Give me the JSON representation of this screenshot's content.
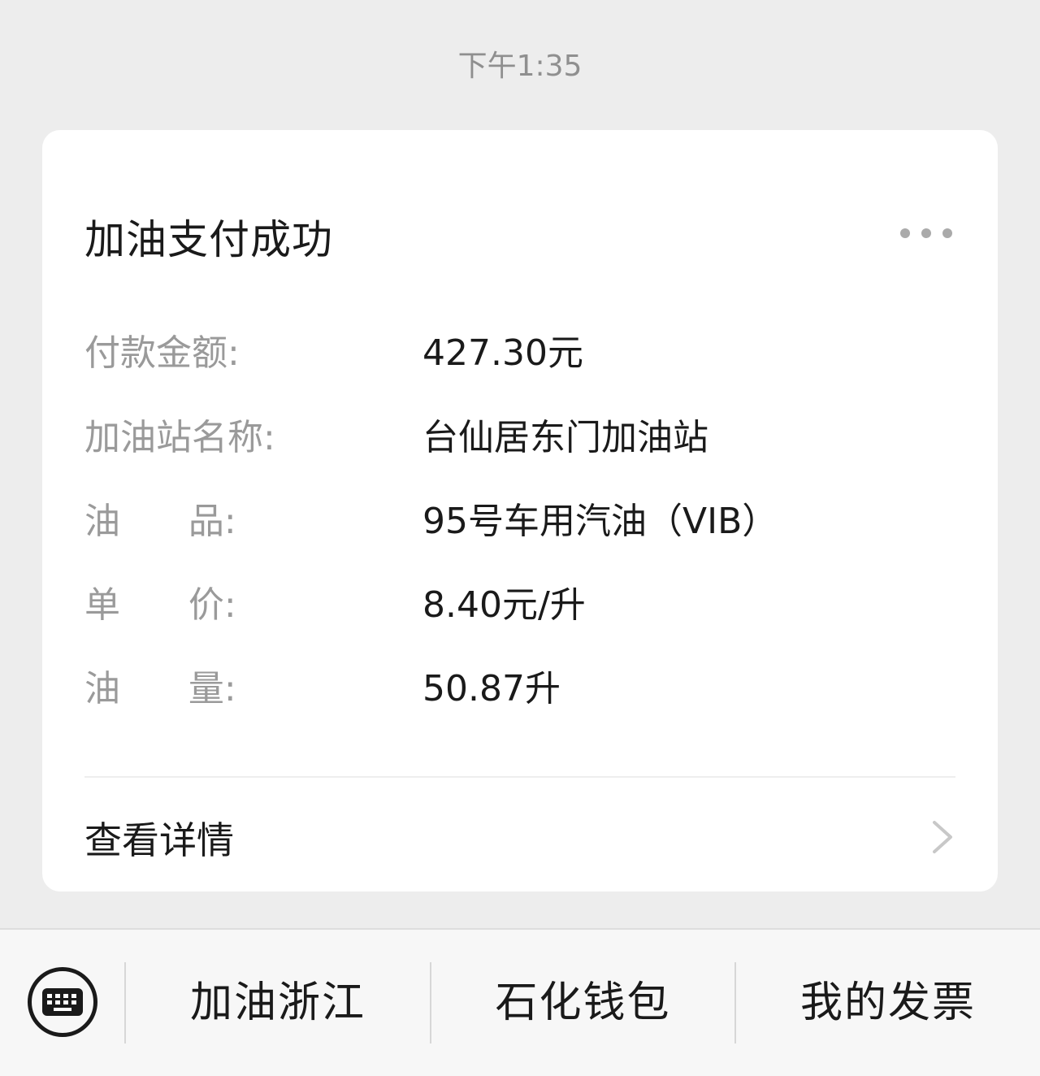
{
  "timestamp": "下午1:35",
  "card": {
    "title": "加油支付成功",
    "rows": [
      {
        "label": "付款金额:",
        "value": "427.30元"
      },
      {
        "label": "加油站名称:",
        "value": "台仙居东门加油站"
      },
      {
        "label": "油      品:",
        "value": "95号车用汽油（VIB）"
      },
      {
        "label": "单      价:",
        "value": "8.40元/升"
      },
      {
        "label": "油      量:",
        "value": "50.87升"
      }
    ],
    "detail_link": "查看详情"
  },
  "bottom_menu": {
    "items": [
      "加油浙江",
      "石化钱包",
      "我的发票"
    ]
  }
}
